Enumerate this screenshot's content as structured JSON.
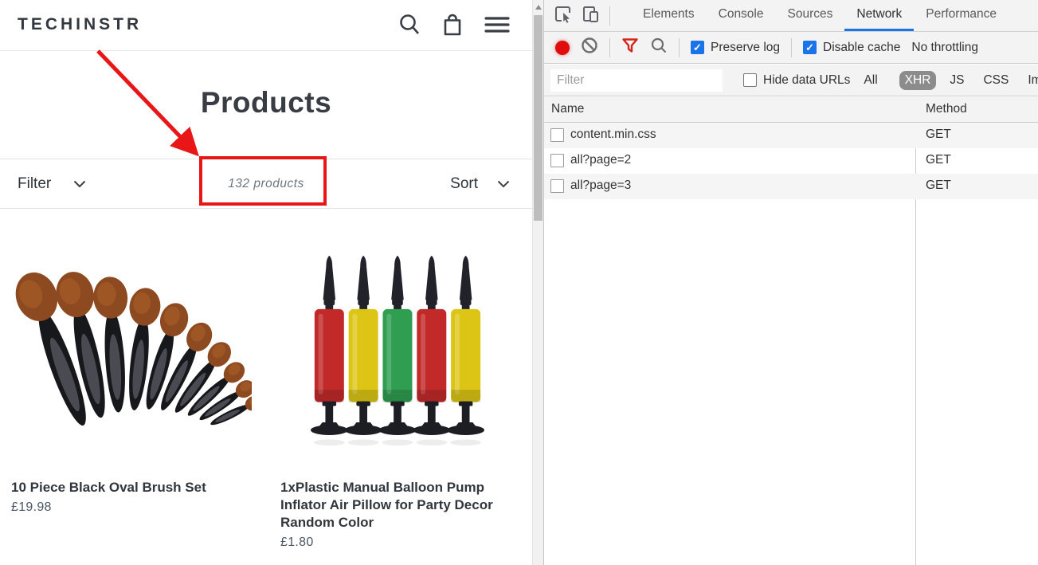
{
  "store": {
    "logo": "TECHINSTR",
    "page_title": "Products",
    "filter_label": "Filter",
    "product_count": "132 products",
    "sort_label": "Sort",
    "products": [
      {
        "title": "10 Piece Black Oval Brush Set",
        "price": "£19.98"
      },
      {
        "title": "1xPlastic Manual Balloon Pump Inflator Air Pillow for Party Decor Random Color",
        "price": "£1.80"
      }
    ]
  },
  "devtools": {
    "tabs": [
      {
        "label": "Elements"
      },
      {
        "label": "Console"
      },
      {
        "label": "Sources"
      },
      {
        "label": "Network"
      },
      {
        "label": "Performance"
      }
    ],
    "active_tab": "Network",
    "toolbar": {
      "preserve_log": "Preserve log",
      "disable_cache": "Disable cache",
      "throttling": "No throttling"
    },
    "filter": {
      "placeholder": "Filter",
      "hide_data_urls": "Hide data URLs",
      "types": [
        "All",
        "XHR",
        "JS",
        "CSS",
        "Im"
      ],
      "active_type": "XHR"
    },
    "table": {
      "columns": {
        "name": "Name",
        "method": "Method"
      },
      "rows": [
        {
          "name": "content.min.css",
          "method": "GET"
        },
        {
          "name": "all?page=2",
          "method": "GET"
        },
        {
          "name": "all?page=3",
          "method": "GET"
        }
      ]
    }
  },
  "icons": {
    "search": "magnifier",
    "cart": "shopping-bag",
    "menu": "hamburger",
    "chevron": "chevron-down",
    "inspect": "cursor-in-box",
    "device_toolbar": "phone-tablet",
    "record": "red-dot",
    "clear": "circle-slash",
    "network_filter": "funnel",
    "search_network": "magnifier"
  },
  "colors": {
    "devtools_accent_blue": "#1a73e8",
    "record_red": "#df0d0d",
    "funnel_red": "#d42516",
    "annotation_red": "#e81616",
    "xhr_pill_gray": "#8c8c8c",
    "store_text": "#33383f",
    "row_alt_gray": "#f5f5f5"
  }
}
